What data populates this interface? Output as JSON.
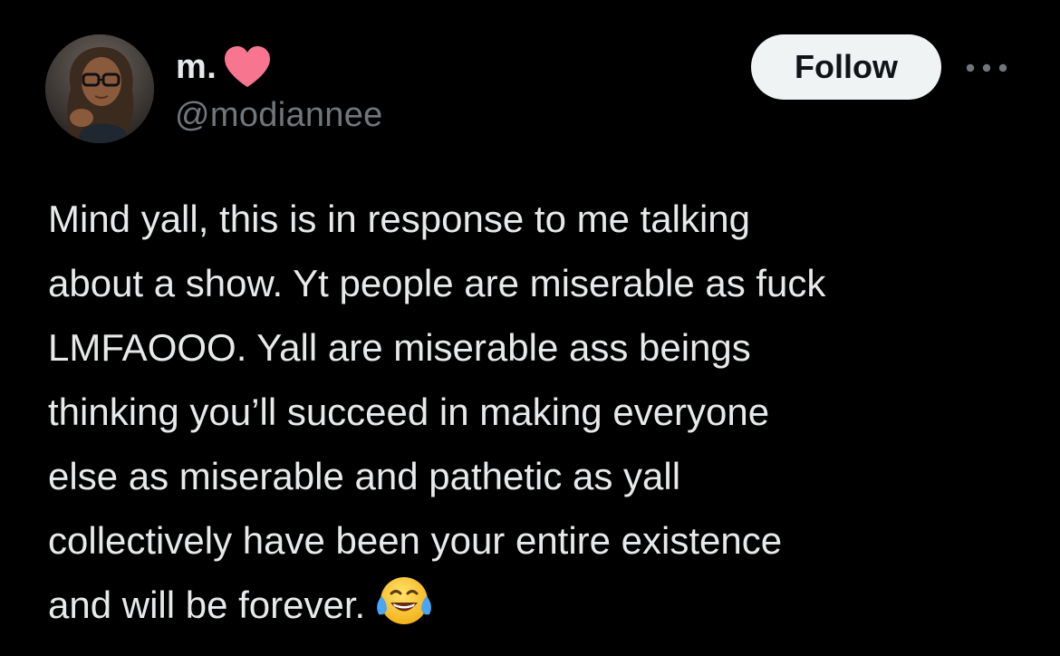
{
  "author": {
    "display_name": "m.",
    "handle": "@modiannee",
    "name_badge_icon": "heart-icon",
    "avatar_icon": "avatar"
  },
  "actions": {
    "follow_label": "Follow",
    "more_icon": "more-dots-icon"
  },
  "tweet": {
    "lines": [
      "Mind yall, this is in response to me talking",
      "about a show. Yt people are miserable as fuck",
      "LMFAOOO. Yall are miserable ass beings",
      "thinking you’ll succeed in making everyone",
      "else as miserable and pathetic as yall",
      "collectively have been your entire existence",
      "and will be forever."
    ],
    "trailing_emoji_icon": "tears-of-joy-emoji-icon"
  },
  "colors": {
    "background": "#000000",
    "primary_text": "#e7e9ea",
    "secondary_text": "#71767b",
    "follow_button_bg": "#eff3f4",
    "follow_button_text": "#0f1419",
    "heart": "#f7758f"
  }
}
